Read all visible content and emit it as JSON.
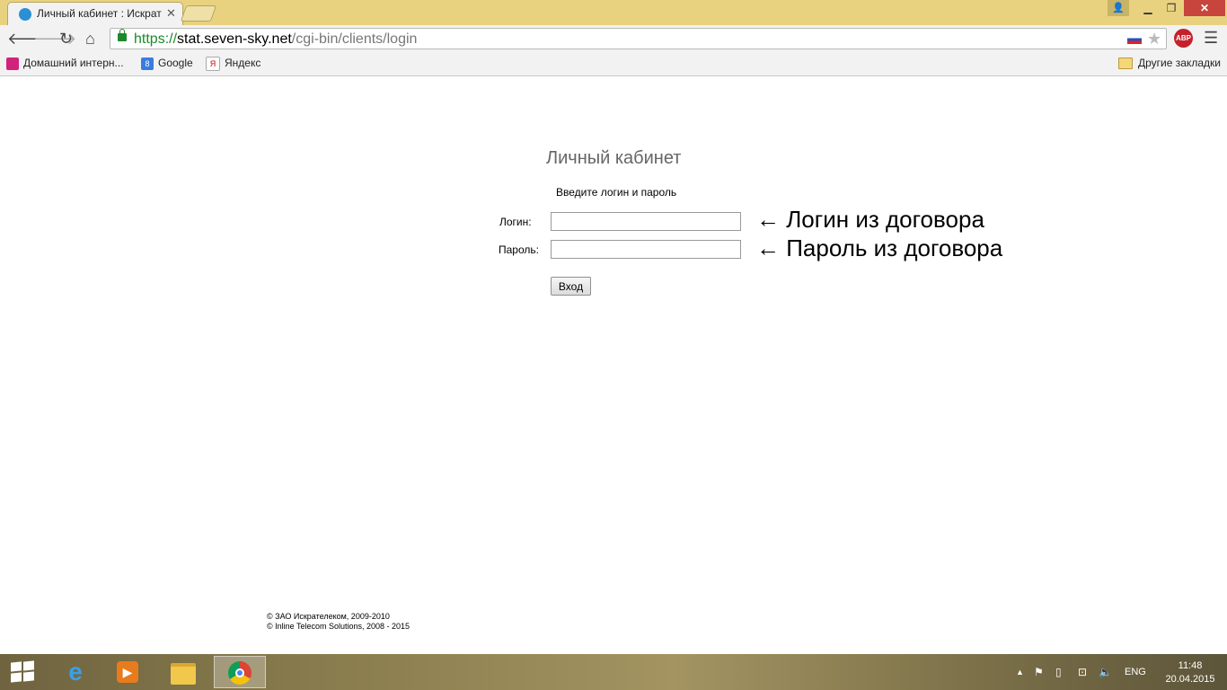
{
  "browser": {
    "tab_title": "Личный кабинет : Искрат",
    "url_scheme": "https://",
    "url_host": "stat.seven-sky.net",
    "url_path": "/cgi-bin/clients/login",
    "abp_label": "ABP"
  },
  "bookmarks": {
    "items": [
      {
        "label": "Домашний интерн..."
      },
      {
        "label": "Google",
        "icon_text": "8"
      },
      {
        "label": "Яндекс",
        "icon_text": "Я"
      }
    ],
    "other_label": "Другие закладки"
  },
  "page": {
    "title": "Личный кабинет",
    "subtitle": "Введите логин и пароль",
    "login_label": "Логин:",
    "password_label": "Пароль:",
    "login_value": "",
    "password_value": "",
    "login_hint": "← Логин из договора",
    "password_hint": "← Пароль из договора",
    "submit_label": "Вход",
    "footer_line1": "© ЗАО Искрателеком, 2009-2010",
    "footer_line2": "© Inline Telecom Solutions, 2008 - 2015"
  },
  "taskbar": {
    "lang": "ENG",
    "time": "11:48",
    "date": "20.04.2015"
  },
  "colors": {
    "title_bar": "#e9d27f",
    "secure_green": "#1c8a2b",
    "abp_red": "#c5202c",
    "close_red": "#c7453c"
  }
}
